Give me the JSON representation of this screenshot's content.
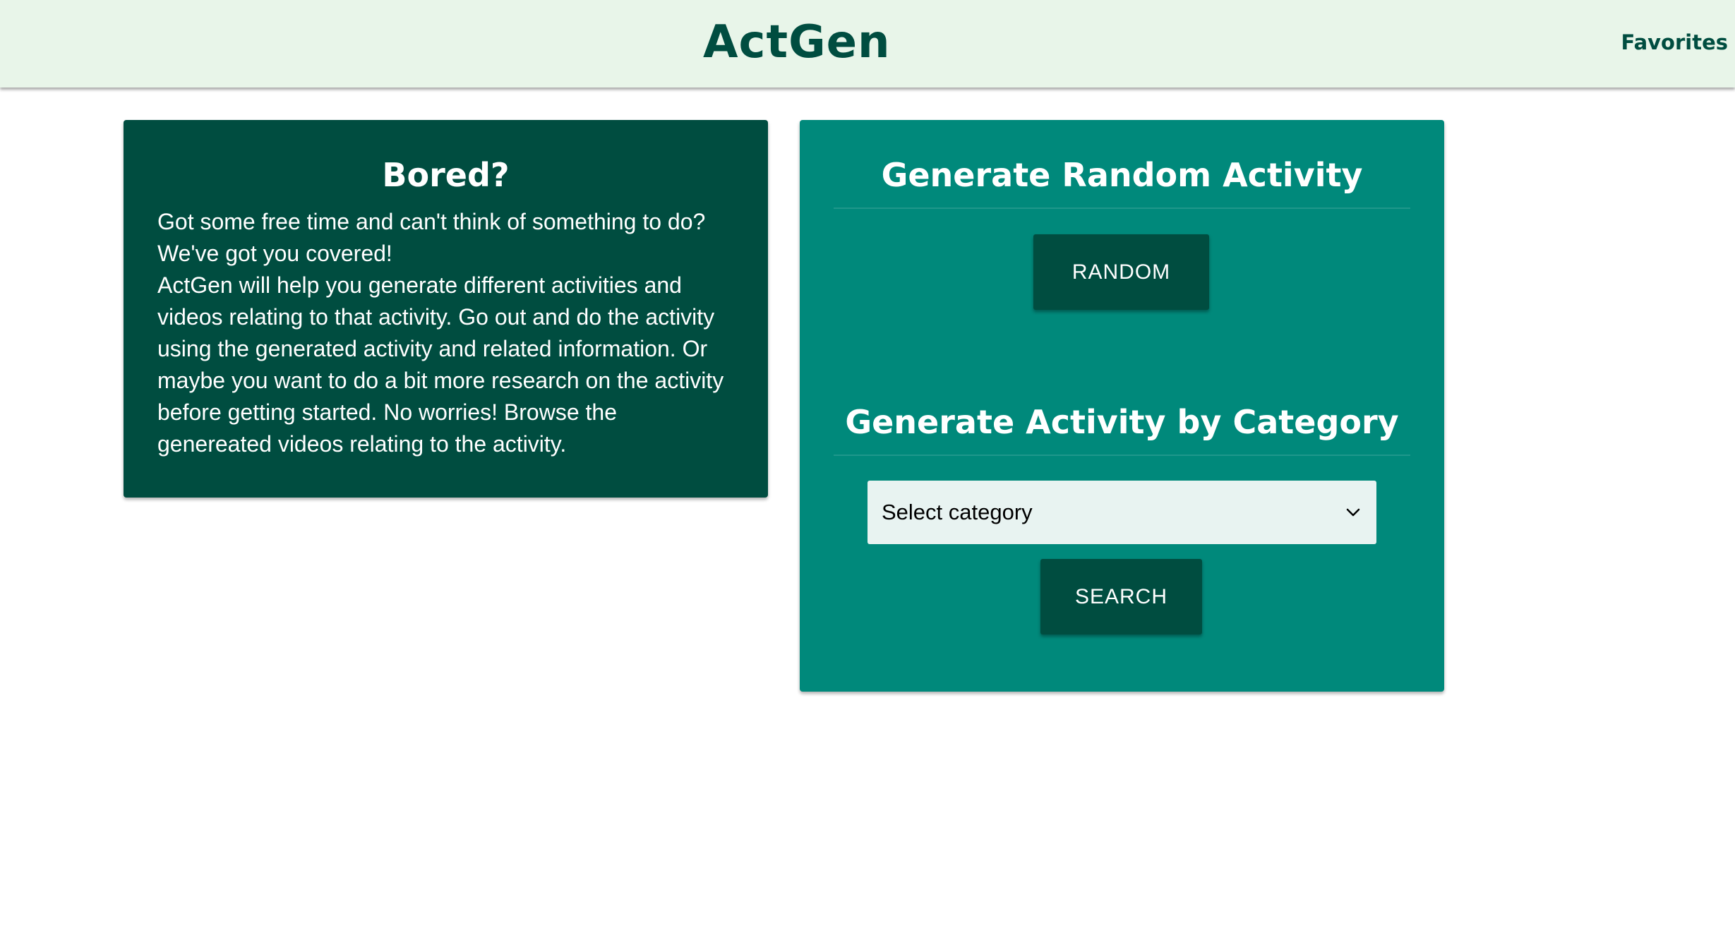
{
  "header": {
    "brand": "ActGen",
    "favorites_link": "Favorites"
  },
  "intro_card": {
    "title": "Bored?",
    "paragraph_1": "Got some free time and can't think of something to do? We've got you covered!",
    "paragraph_2": "ActGen will help you generate different activities and videos relating to that activity. Go out and do the activity using the generated activity and related information. Or maybe you want to do a bit more research on the activity before getting started. No worries! Browse the genereated videos relating to the activity."
  },
  "generator_card": {
    "random_title": "Generate Random Activity",
    "random_button": "RANDOM",
    "category_title": "Generate Activity by Category",
    "category_select": {
      "selected": "Select category"
    },
    "search_button": "SEARCH"
  },
  "icons": {
    "select_chevron": "chevron-down-icon"
  },
  "colors": {
    "header_bg": "#e8f5e9",
    "brand_text": "#004d40",
    "intro_card_bg": "#004d40",
    "generator_card_bg": "#00897b",
    "button_bg": "#004d40",
    "select_bg": "#e8f3f1"
  }
}
